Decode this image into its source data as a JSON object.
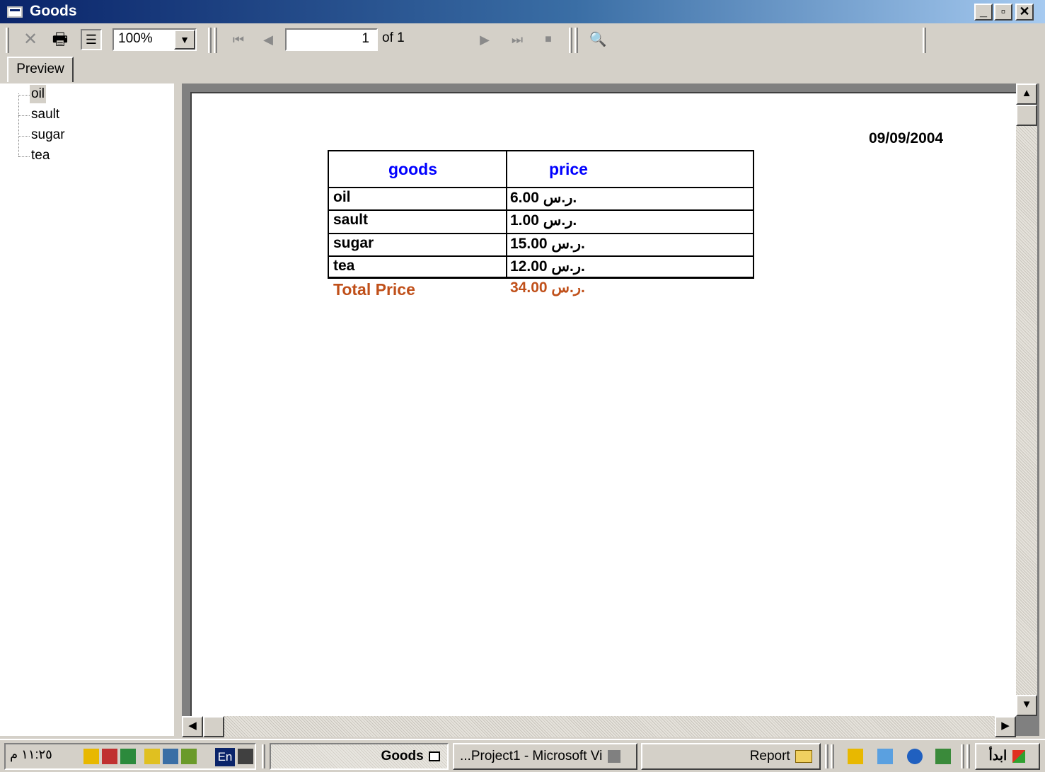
{
  "window": {
    "title": "Goods",
    "minimize_label": "_",
    "restore_label": "▫",
    "close_label": "✕"
  },
  "toolbar": {
    "close_icon": "✕",
    "print_icon": "🖶",
    "tree_icon": "☰",
    "zoom_value": "100%",
    "zoom_drop_icon": "▼",
    "first_icon": "⏮",
    "prev_icon": "◀",
    "page_value": "1",
    "page_of": "of 1",
    "next_icon": "▶",
    "last_icon": "⏭",
    "stop_icon": "■",
    "search_icon": "🔍"
  },
  "tabs": {
    "preview": "Preview"
  },
  "tree": {
    "items": [
      "oil",
      "sault",
      "sugar",
      "tea"
    ]
  },
  "report": {
    "date": "09/09/2004",
    "headers": {
      "goods": "goods",
      "price": "price"
    },
    "rows": [
      {
        "goods": "oil",
        "price": "6.00 ر.س."
      },
      {
        "goods": "sault",
        "price": "1.00 ر.س."
      },
      {
        "goods": "sugar",
        "price": "15.00 ر.س."
      },
      {
        "goods": "tea",
        "price": "12.00 ر.س."
      }
    ],
    "total_label": "Total Price",
    "total_value": "34.00 ر.س."
  },
  "scroll": {
    "up": "▲",
    "down": "▼",
    "left": "◀",
    "right": "▶"
  },
  "taskbar": {
    "clock": "١١:٢٥ م",
    "lang": "En",
    "tasks": [
      "Goods",
      "...Project1 - Microsoft Vi",
      "Report"
    ],
    "start": "ابدأ"
  },
  "colors": {
    "title_start": "#0a246a",
    "title_end": "#a6caf0",
    "header_text": "#0000ff",
    "total_text": "#c0501a"
  }
}
